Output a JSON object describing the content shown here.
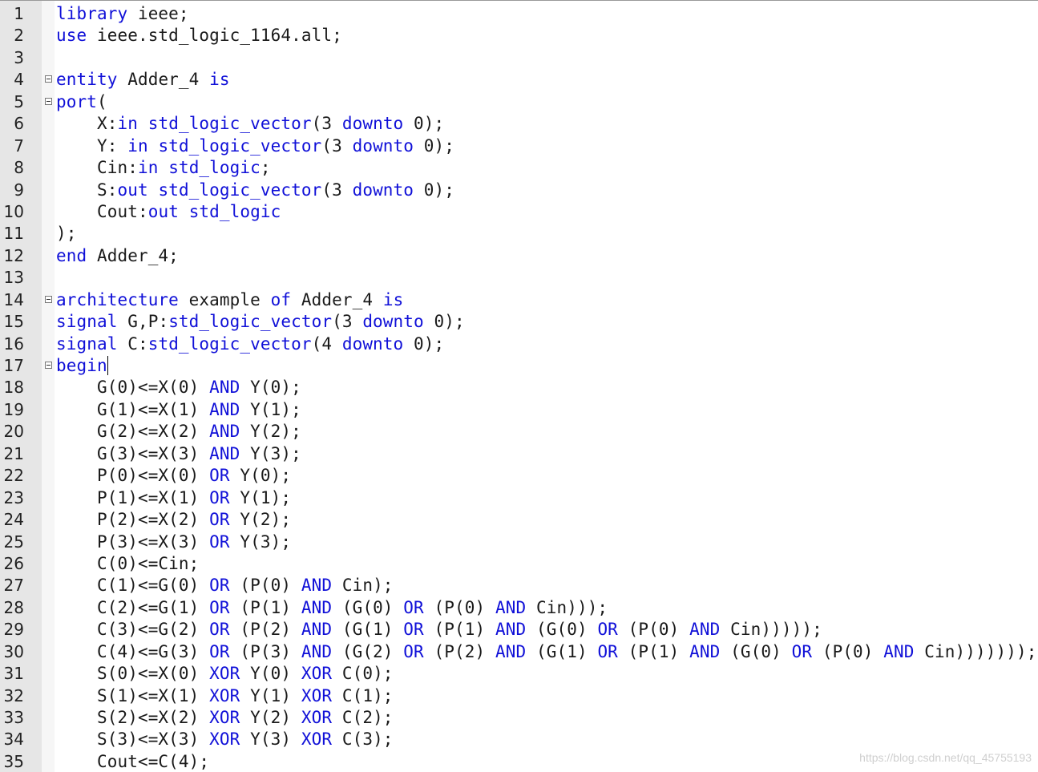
{
  "editor": {
    "language": "VHDL",
    "colors": {
      "keyword": "#1010d8",
      "text": "#1a1a1a",
      "gutter_bg": "#e6e6e6",
      "editor_bg": "#ffffff"
    },
    "caret_line": 17,
    "lines": [
      {
        "n": "1",
        "fold": false,
        "tokens": [
          [
            "kw",
            "library"
          ],
          [
            "tx",
            " ieee;"
          ]
        ]
      },
      {
        "n": "2",
        "fold": false,
        "tokens": [
          [
            "kw",
            "use"
          ],
          [
            "tx",
            " ieee.std_logic_1164.all;"
          ]
        ]
      },
      {
        "n": "3",
        "fold": false,
        "tokens": []
      },
      {
        "n": "4",
        "fold": true,
        "tokens": [
          [
            "kw",
            "entity"
          ],
          [
            "tx",
            " Adder_4 "
          ],
          [
            "kw",
            "is"
          ]
        ]
      },
      {
        "n": "5",
        "fold": true,
        "tokens": [
          [
            "kw",
            "port"
          ],
          [
            "tx",
            "("
          ]
        ]
      },
      {
        "n": "6",
        "fold": false,
        "tokens": [
          [
            "tx",
            "    X:"
          ],
          [
            "kw",
            "in"
          ],
          [
            "tx",
            " "
          ],
          [
            "kw",
            "std_logic_vector"
          ],
          [
            "tx",
            "(3 "
          ],
          [
            "kw",
            "downto"
          ],
          [
            "tx",
            " 0);"
          ]
        ]
      },
      {
        "n": "7",
        "fold": false,
        "tokens": [
          [
            "tx",
            "    Y: "
          ],
          [
            "kw",
            "in"
          ],
          [
            "tx",
            " "
          ],
          [
            "kw",
            "std_logic_vector"
          ],
          [
            "tx",
            "(3 "
          ],
          [
            "kw",
            "downto"
          ],
          [
            "tx",
            " 0);"
          ]
        ]
      },
      {
        "n": "8",
        "fold": false,
        "tokens": [
          [
            "tx",
            "    Cin:"
          ],
          [
            "kw",
            "in"
          ],
          [
            "tx",
            " "
          ],
          [
            "kw",
            "std_logic"
          ],
          [
            "tx",
            ";"
          ]
        ]
      },
      {
        "n": "9",
        "fold": false,
        "tokens": [
          [
            "tx",
            "    S:"
          ],
          [
            "kw",
            "out"
          ],
          [
            "tx",
            " "
          ],
          [
            "kw",
            "std_logic_vector"
          ],
          [
            "tx",
            "(3 "
          ],
          [
            "kw",
            "downto"
          ],
          [
            "tx",
            " 0);"
          ]
        ]
      },
      {
        "n": "10",
        "fold": false,
        "tokens": [
          [
            "tx",
            "    Cout:"
          ],
          [
            "kw",
            "out"
          ],
          [
            "tx",
            " "
          ],
          [
            "kw",
            "std_logic"
          ]
        ]
      },
      {
        "n": "11",
        "fold": false,
        "tokens": [
          [
            "tx",
            ");"
          ]
        ]
      },
      {
        "n": "12",
        "fold": false,
        "tokens": [
          [
            "kw",
            "end"
          ],
          [
            "tx",
            " Adder_4;"
          ]
        ]
      },
      {
        "n": "13",
        "fold": false,
        "tokens": []
      },
      {
        "n": "14",
        "fold": true,
        "tokens": [
          [
            "kw",
            "architecture"
          ],
          [
            "tx",
            " example "
          ],
          [
            "kw",
            "of"
          ],
          [
            "tx",
            " Adder_4 "
          ],
          [
            "kw",
            "is"
          ]
        ]
      },
      {
        "n": "15",
        "fold": false,
        "tokens": [
          [
            "kw",
            "signal"
          ],
          [
            "tx",
            " G,P:"
          ],
          [
            "kw",
            "std_logic_vector"
          ],
          [
            "tx",
            "(3 "
          ],
          [
            "kw",
            "downto"
          ],
          [
            "tx",
            " 0);"
          ]
        ]
      },
      {
        "n": "16",
        "fold": false,
        "tokens": [
          [
            "kw",
            "signal"
          ],
          [
            "tx",
            " C:"
          ],
          [
            "kw",
            "std_logic_vector"
          ],
          [
            "tx",
            "(4 "
          ],
          [
            "kw",
            "downto"
          ],
          [
            "tx",
            " 0);"
          ]
        ]
      },
      {
        "n": "17",
        "fold": true,
        "tokens": [
          [
            "kw",
            "begin"
          ]
        ]
      },
      {
        "n": "18",
        "fold": false,
        "tokens": [
          [
            "tx",
            "    G(0)<=X(0) "
          ],
          [
            "kw",
            "AND"
          ],
          [
            "tx",
            " Y(0);"
          ]
        ]
      },
      {
        "n": "19",
        "fold": false,
        "tokens": [
          [
            "tx",
            "    G(1)<=X(1) "
          ],
          [
            "kw",
            "AND"
          ],
          [
            "tx",
            " Y(1);"
          ]
        ]
      },
      {
        "n": "20",
        "fold": false,
        "tokens": [
          [
            "tx",
            "    G(2)<=X(2) "
          ],
          [
            "kw",
            "AND"
          ],
          [
            "tx",
            " Y(2);"
          ]
        ]
      },
      {
        "n": "21",
        "fold": false,
        "tokens": [
          [
            "tx",
            "    G(3)<=X(3) "
          ],
          [
            "kw",
            "AND"
          ],
          [
            "tx",
            " Y(3);"
          ]
        ]
      },
      {
        "n": "22",
        "fold": false,
        "tokens": [
          [
            "tx",
            "    P(0)<=X(0) "
          ],
          [
            "kw",
            "OR"
          ],
          [
            "tx",
            " Y(0);"
          ]
        ]
      },
      {
        "n": "23",
        "fold": false,
        "tokens": [
          [
            "tx",
            "    P(1)<=X(1) "
          ],
          [
            "kw",
            "OR"
          ],
          [
            "tx",
            " Y(1);"
          ]
        ]
      },
      {
        "n": "24",
        "fold": false,
        "tokens": [
          [
            "tx",
            "    P(2)<=X(2) "
          ],
          [
            "kw",
            "OR"
          ],
          [
            "tx",
            " Y(2);"
          ]
        ]
      },
      {
        "n": "25",
        "fold": false,
        "tokens": [
          [
            "tx",
            "    P(3)<=X(3) "
          ],
          [
            "kw",
            "OR"
          ],
          [
            "tx",
            " Y(3);"
          ]
        ]
      },
      {
        "n": "26",
        "fold": false,
        "tokens": [
          [
            "tx",
            "    C(0)<=Cin;"
          ]
        ]
      },
      {
        "n": "27",
        "fold": false,
        "tokens": [
          [
            "tx",
            "    C(1)<=G(0) "
          ],
          [
            "kw",
            "OR"
          ],
          [
            "tx",
            " (P(0) "
          ],
          [
            "kw",
            "AND"
          ],
          [
            "tx",
            " Cin);"
          ]
        ]
      },
      {
        "n": "28",
        "fold": false,
        "tokens": [
          [
            "tx",
            "    C(2)<=G(1) "
          ],
          [
            "kw",
            "OR"
          ],
          [
            "tx",
            " (P(1) "
          ],
          [
            "kw",
            "AND"
          ],
          [
            "tx",
            " (G(0) "
          ],
          [
            "kw",
            "OR"
          ],
          [
            "tx",
            " (P(0) "
          ],
          [
            "kw",
            "AND"
          ],
          [
            "tx",
            " Cin)));"
          ]
        ]
      },
      {
        "n": "29",
        "fold": false,
        "tokens": [
          [
            "tx",
            "    C(3)<=G(2) "
          ],
          [
            "kw",
            "OR"
          ],
          [
            "tx",
            " (P(2) "
          ],
          [
            "kw",
            "AND"
          ],
          [
            "tx",
            " (G(1) "
          ],
          [
            "kw",
            "OR"
          ],
          [
            "tx",
            " (P(1) "
          ],
          [
            "kw",
            "AND"
          ],
          [
            "tx",
            " (G(0) "
          ],
          [
            "kw",
            "OR"
          ],
          [
            "tx",
            " (P(0) "
          ],
          [
            "kw",
            "AND"
          ],
          [
            "tx",
            " Cin)))));"
          ]
        ]
      },
      {
        "n": "30",
        "fold": false,
        "tokens": [
          [
            "tx",
            "    C(4)<=G(3) "
          ],
          [
            "kw",
            "OR"
          ],
          [
            "tx",
            " (P(3) "
          ],
          [
            "kw",
            "AND"
          ],
          [
            "tx",
            " (G(2) "
          ],
          [
            "kw",
            "OR"
          ],
          [
            "tx",
            " (P(2) "
          ],
          [
            "kw",
            "AND"
          ],
          [
            "tx",
            " (G(1) "
          ],
          [
            "kw",
            "OR"
          ],
          [
            "tx",
            " (P(1) "
          ],
          [
            "kw",
            "AND"
          ],
          [
            "tx",
            " (G(0) "
          ],
          [
            "kw",
            "OR"
          ],
          [
            "tx",
            " (P(0) "
          ],
          [
            "kw",
            "AND"
          ],
          [
            "tx",
            " Cin)))))));"
          ]
        ]
      },
      {
        "n": "31",
        "fold": false,
        "tokens": [
          [
            "tx",
            "    S(0)<=X(0) "
          ],
          [
            "kw",
            "XOR"
          ],
          [
            "tx",
            " Y(0) "
          ],
          [
            "kw",
            "XOR"
          ],
          [
            "tx",
            " C(0);"
          ]
        ]
      },
      {
        "n": "32",
        "fold": false,
        "tokens": [
          [
            "tx",
            "    S(1)<=X(1) "
          ],
          [
            "kw",
            "XOR"
          ],
          [
            "tx",
            " Y(1) "
          ],
          [
            "kw",
            "XOR"
          ],
          [
            "tx",
            " C(1);"
          ]
        ]
      },
      {
        "n": "33",
        "fold": false,
        "tokens": [
          [
            "tx",
            "    S(2)<=X(2) "
          ],
          [
            "kw",
            "XOR"
          ],
          [
            "tx",
            " Y(2) "
          ],
          [
            "kw",
            "XOR"
          ],
          [
            "tx",
            " C(2);"
          ]
        ]
      },
      {
        "n": "34",
        "fold": false,
        "tokens": [
          [
            "tx",
            "    S(3)<=X(3) "
          ],
          [
            "kw",
            "XOR"
          ],
          [
            "tx",
            " Y(3) "
          ],
          [
            "kw",
            "XOR"
          ],
          [
            "tx",
            " C(3);"
          ]
        ]
      },
      {
        "n": "35",
        "fold": false,
        "tokens": [
          [
            "tx",
            "    Cout<=C(4);"
          ]
        ]
      }
    ]
  },
  "watermark": "https://blog.csdn.net/qq_45755193"
}
